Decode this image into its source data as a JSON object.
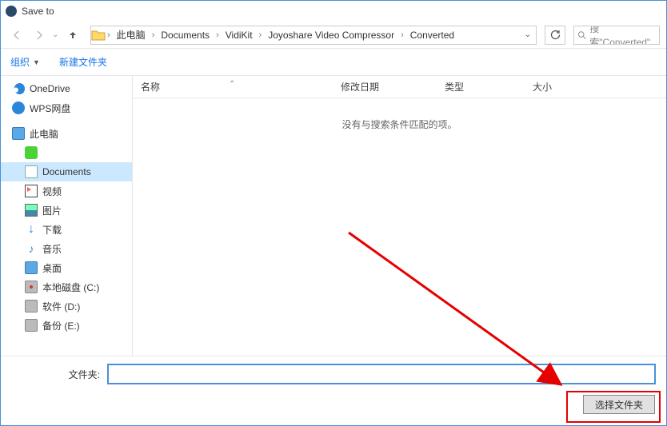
{
  "title": "Save to",
  "breadcrumb": {
    "items": [
      "此电脑",
      "Documents",
      "VidiKit",
      "Joyoshare Video Compressor",
      "Converted"
    ]
  },
  "search": {
    "placeholder": "搜索\"Converted\""
  },
  "toolbar": {
    "organize": "组织",
    "newfolder": "新建文件夹"
  },
  "sidebar": {
    "onedrive": "OneDrive",
    "wps": "WPS网盘",
    "pc": "此电脑",
    "green": "",
    "documents": "Documents",
    "videos": "视频",
    "pictures": "图片",
    "downloads": "下载",
    "music": "音乐",
    "desktop": "桌面",
    "localc": "本地磁盘 (C:)",
    "drived": "软件 (D:)",
    "drivee": "备份 (E:)"
  },
  "columns": {
    "name": "名称",
    "date": "修改日期",
    "type": "类型",
    "size": "大小"
  },
  "empty_text": "没有与搜索条件匹配的项。",
  "folder_label": "文件夹:",
  "folder_value": "",
  "select_button": "选择文件夹"
}
